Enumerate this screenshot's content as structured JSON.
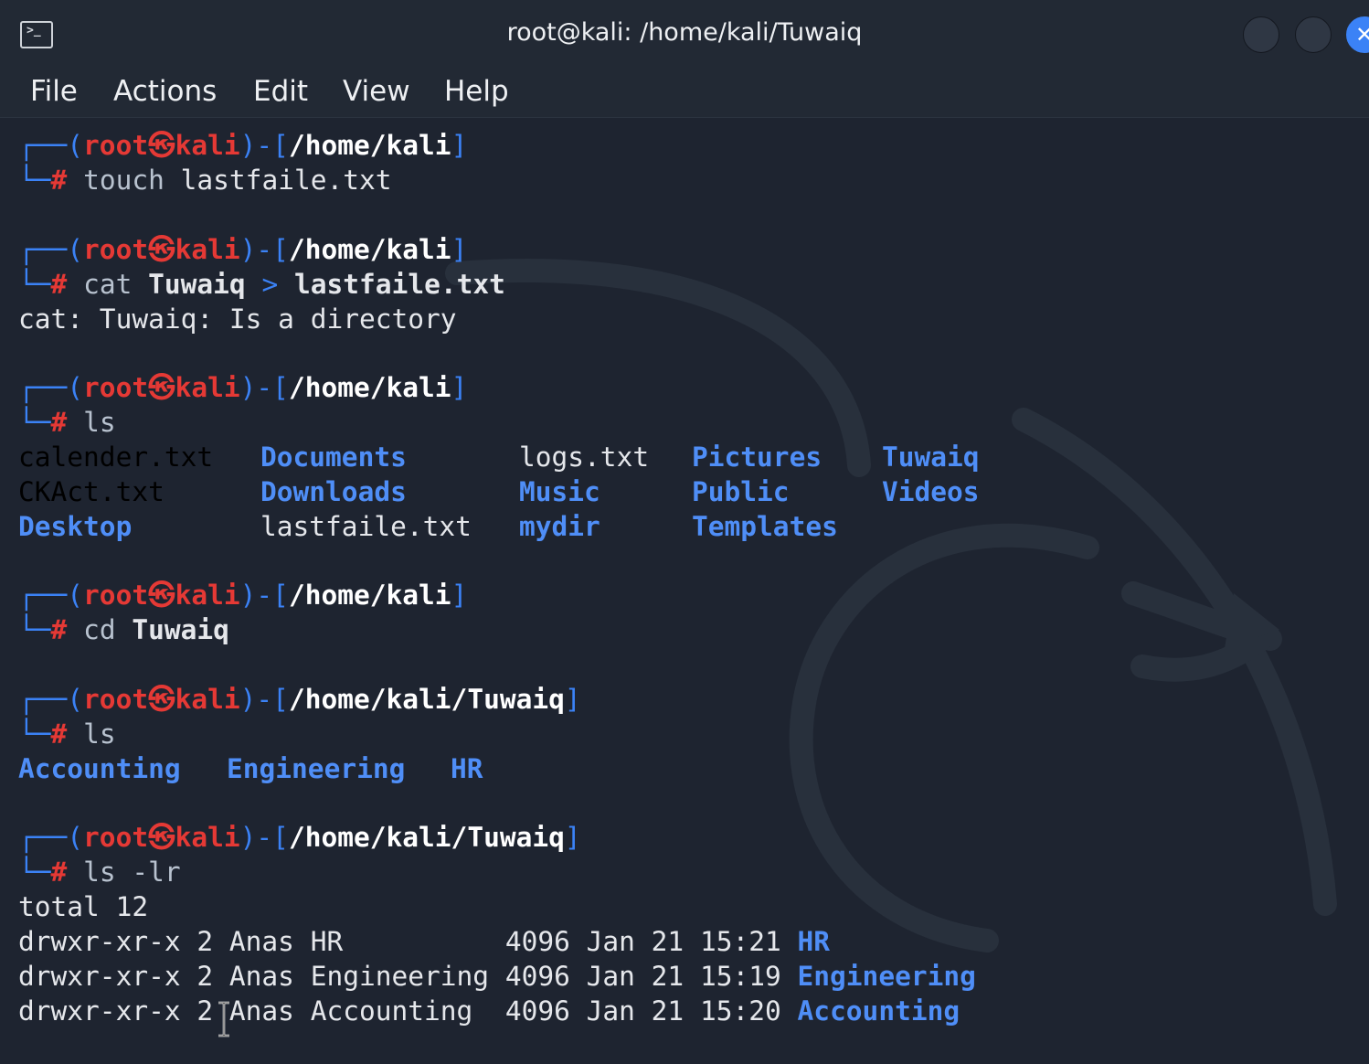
{
  "window": {
    "title": "root@kali: /home/kali/Tuwaiq",
    "close_glyph": "✕"
  },
  "menu": [
    "File",
    "Actions",
    "Edit",
    "View",
    "Help"
  ],
  "prompt": {
    "user": "root",
    "host": "kali",
    "at_glyph": "㉿",
    "hash": "#"
  },
  "blocks": [
    {
      "path": "/home/kali",
      "cmd": "touch",
      "args": "lastfaile.txt"
    },
    {
      "path": "/home/kali",
      "cmd": "cat",
      "args_parts": [
        "Tuwaiq",
        ">",
        "lastfaile.txt"
      ],
      "output": "cat: Tuwaiq: Is a directory"
    },
    {
      "path": "/home/kali",
      "cmd": "ls"
    },
    {
      "path": "/home/kali",
      "cmd": "cd",
      "args": "Tuwaiq"
    },
    {
      "path": "/home/kali/Tuwaiq",
      "cmd": "ls"
    },
    {
      "path": "/home/kali/Tuwaiq",
      "cmd": "ls -lr"
    }
  ],
  "ls_home": {
    "col1": [
      "calender.txt",
      "CKAct.txt",
      "Desktop"
    ],
    "col2": [
      "Documents",
      "Downloads",
      "lastfaile.txt"
    ],
    "col3": [
      "logs.txt",
      "Music",
      "mydir"
    ],
    "col4": [
      "Pictures",
      "Public",
      "Templates"
    ],
    "col5": [
      "Tuwaiq",
      "Videos"
    ]
  },
  "ls_tuwaiq": [
    "Accounting",
    "Engineering",
    "HR"
  ],
  "ls_lr": {
    "total": "total 12",
    "rows": [
      {
        "perms": "drwxr-xr-x 2 Anas HR          4096 Jan 21 15:21",
        "name": "HR"
      },
      {
        "perms": "drwxr-xr-x 2 Anas Engineering 4096 Jan 21 15:19",
        "name": "Engineering"
      },
      {
        "perms": "drwxr-xr-x 2 Anas Accounting  4096 Jan 21 15:20",
        "name": "Accounting"
      }
    ]
  },
  "colors": {
    "background": "#1e2430",
    "prompt_bracket": "#3b82f6",
    "user_host": "#e53935",
    "directory": "#4f8ef7"
  }
}
